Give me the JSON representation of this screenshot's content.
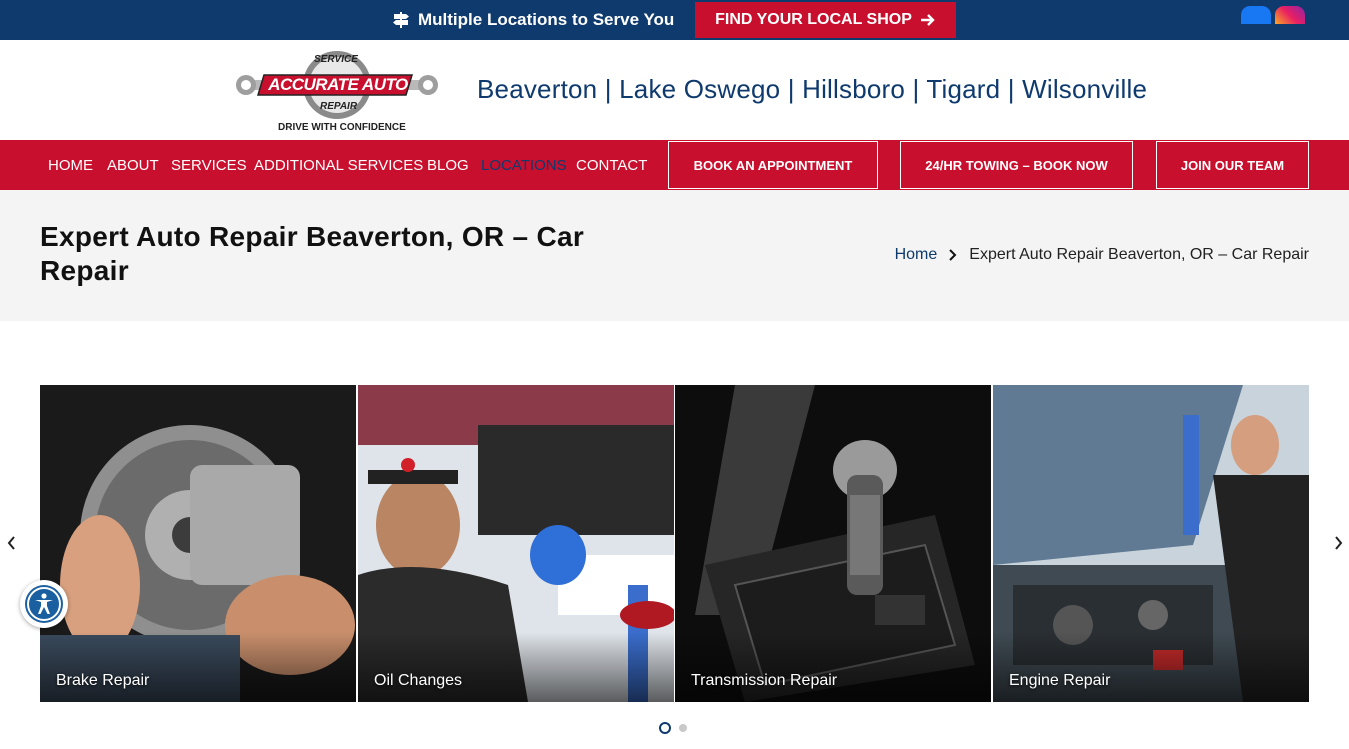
{
  "topbar": {
    "locations_text": "Multiple Locations to Serve You",
    "find_shop_label": "FIND YOUR LOCAL SHOP",
    "social": [
      "facebook-icon",
      "instagram-icon"
    ]
  },
  "header": {
    "logo_top": "SERVICE",
    "logo_main": "ACCURATE AUTO",
    "logo_bottom": "REPAIR",
    "logo_tagline": "DRIVE WITH CONFIDENCE",
    "cities": "Beaverton | Lake Oswego | Hillsboro | Tigard | Wilsonville"
  },
  "nav": {
    "items": [
      "HOME",
      "ABOUT",
      "SERVICES",
      "ADDITIONAL SERVICES",
      "BLOG",
      "LOCATIONS",
      "CONTACT"
    ],
    "active": "LOCATIONS",
    "buttons": [
      "BOOK AN APPOINTMENT",
      "24/HR TOWING – BOOK NOW",
      "JOIN OUR TEAM"
    ]
  },
  "page": {
    "title": "Expert Auto Repair Beaverton, OR – Car Repair",
    "breadcrumb_home": "Home",
    "breadcrumb_current": "Expert Auto Repair Beaverton, OR – Car Repair"
  },
  "carousel": {
    "cards": [
      "Brake Repair",
      "Oil Changes",
      "Transmission Repair",
      "Engine Repair"
    ],
    "active_dot": 1,
    "dot_count": 2
  },
  "colors": {
    "navy": "#0e3a6e",
    "red": "#c8102e",
    "light_gray": "#f4f4f4"
  }
}
